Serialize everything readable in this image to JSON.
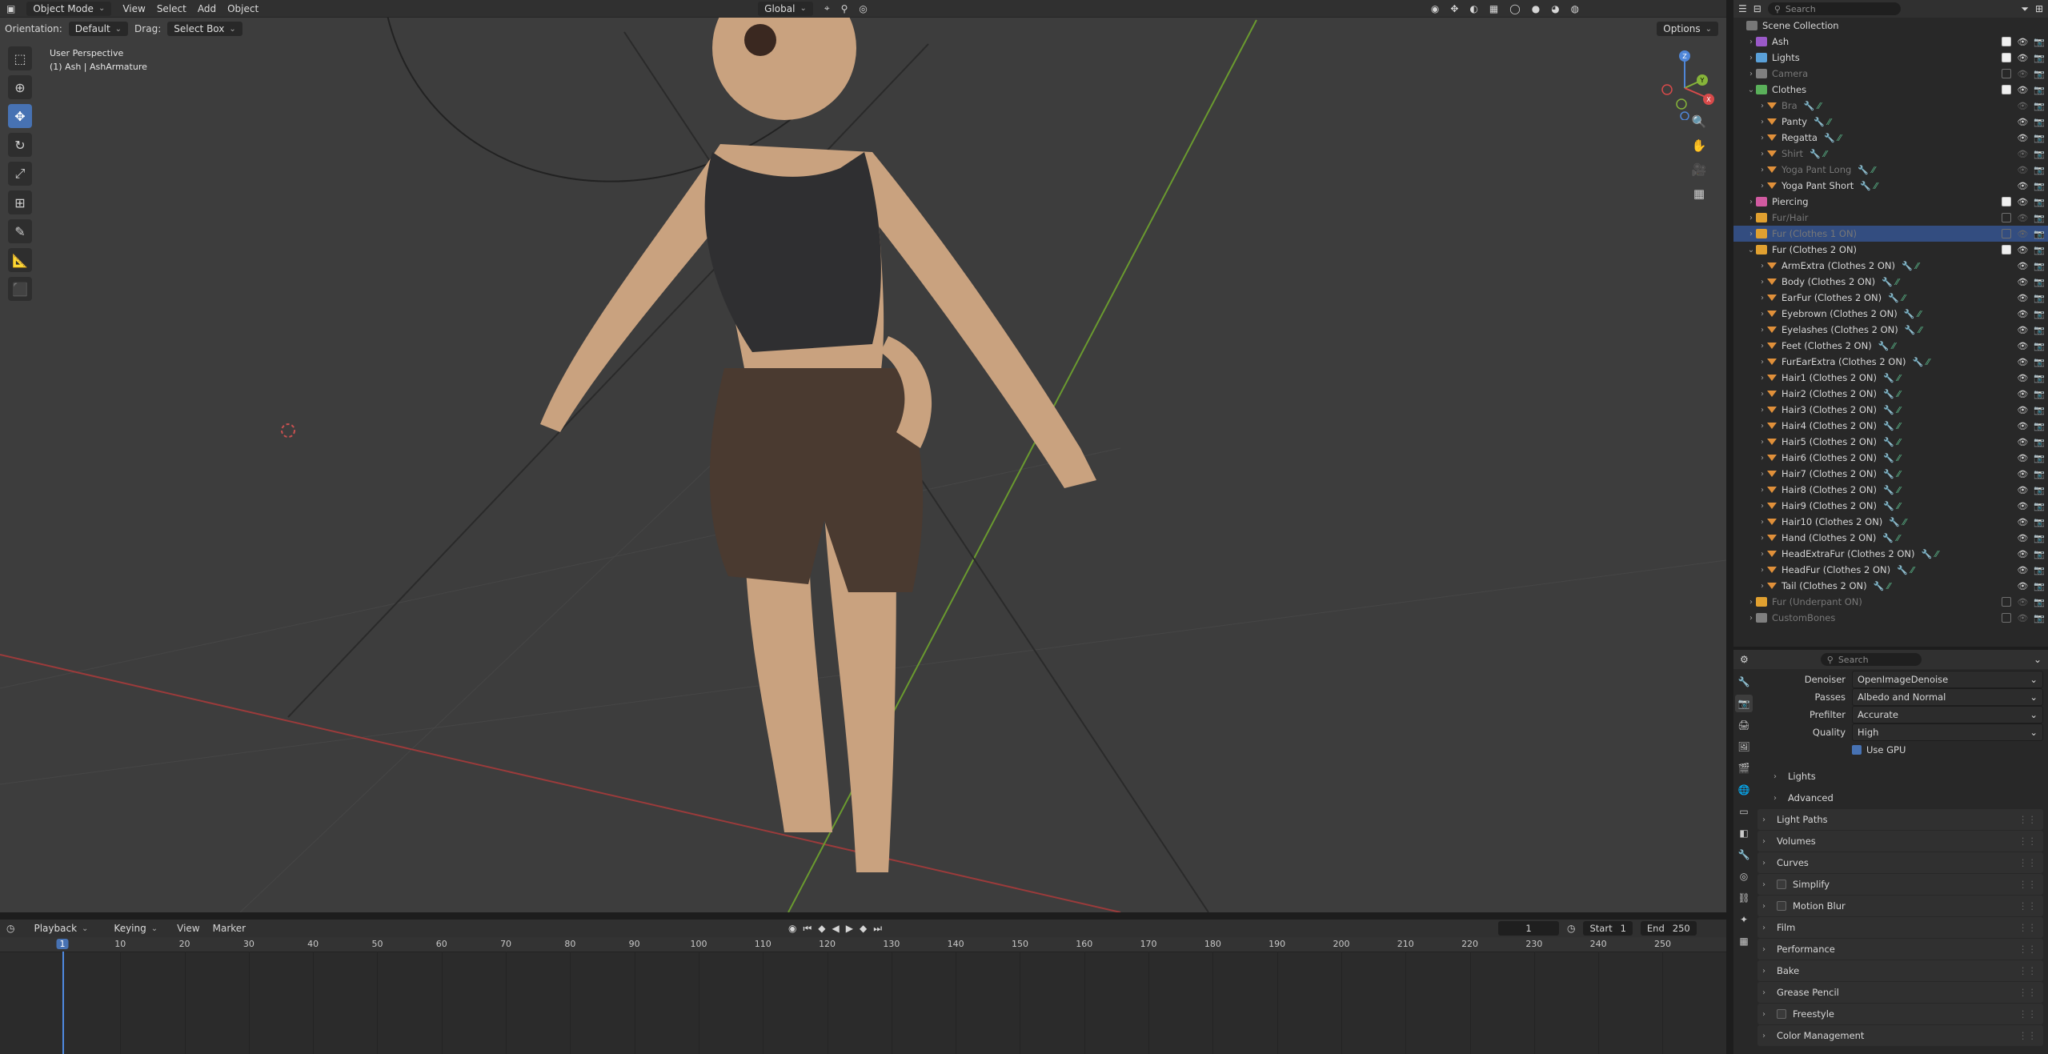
{
  "viewport": {
    "header": {
      "editor_icon": "3d-viewport-icon",
      "mode": "Object Mode",
      "menus": [
        "View",
        "Select",
        "Add",
        "Object"
      ],
      "transform": "Global",
      "options": "Options"
    },
    "header2": {
      "orientation_label": "Orientation:",
      "orientation_value": "Default",
      "drag_label": "Drag:",
      "drag_value": "Select Box"
    },
    "overlay": {
      "perspective": "User Perspective",
      "object": "(1) Ash | AshArmature"
    },
    "gizmo": {
      "x": "X",
      "y": "Y",
      "z": "Z"
    }
  },
  "outliner": {
    "search_placeholder": "Search",
    "root": "Scene Collection",
    "rows": [
      {
        "label": "Ash",
        "indent": 1,
        "color": "#9a59c8",
        "checked": true,
        "dim": false,
        "expanded": false
      },
      {
        "label": "Lights",
        "indent": 1,
        "color": "#5aa0d8",
        "checked": true,
        "dim": false,
        "expanded": false
      },
      {
        "label": "Camera",
        "indent": 1,
        "color": "#7f7f7f",
        "checked": false,
        "dim": true,
        "expanded": false
      },
      {
        "label": "Clothes",
        "indent": 1,
        "color": "#5ab05a",
        "checked": true,
        "dim": false,
        "expanded": true
      },
      {
        "label": "Bra",
        "indent": 2,
        "color": "#e0903a",
        "checked": null,
        "dim": true,
        "expanded": false
      },
      {
        "label": "Panty",
        "indent": 2,
        "color": "#e0903a",
        "checked": null,
        "dim": false,
        "expanded": false
      },
      {
        "label": "Regatta",
        "indent": 2,
        "color": "#e0903a",
        "checked": null,
        "dim": false,
        "expanded": false
      },
      {
        "label": "Shirt",
        "indent": 2,
        "color": "#e0903a",
        "checked": null,
        "dim": true,
        "expanded": false
      },
      {
        "label": "Yoga Pant Long",
        "indent": 2,
        "color": "#e0903a",
        "checked": null,
        "dim": true,
        "expanded": false
      },
      {
        "label": "Yoga Pant Short",
        "indent": 2,
        "color": "#e0903a",
        "checked": null,
        "dim": false,
        "expanded": false
      },
      {
        "label": "Piercing",
        "indent": 1,
        "color": "#d05aa0",
        "checked": true,
        "dim": false,
        "expanded": false
      },
      {
        "label": "Fur/Hair",
        "indent": 1,
        "color": "#e0a030",
        "checked": false,
        "dim": true,
        "expanded": false
      },
      {
        "label": "Fur (Clothes 1 ON)",
        "indent": 1,
        "color": "#e0a030",
        "checked": false,
        "dim": true,
        "expanded": false,
        "selected": true
      },
      {
        "label": "Fur (Clothes 2 ON)",
        "indent": 1,
        "color": "#e0a030",
        "checked": true,
        "dim": false,
        "expanded": true
      },
      {
        "label": "ArmExtra (Clothes 2 ON)",
        "indent": 2,
        "color": "#e0903a",
        "checked": null,
        "dim": false
      },
      {
        "label": "Body (Clothes 2 ON)",
        "indent": 2,
        "color": "#e0903a",
        "checked": null,
        "dim": false
      },
      {
        "label": "EarFur (Clothes 2 ON)",
        "indent": 2,
        "color": "#e0903a",
        "checked": null,
        "dim": false
      },
      {
        "label": "Eyebrown (Clothes 2 ON)",
        "indent": 2,
        "color": "#e0903a",
        "checked": null,
        "dim": false
      },
      {
        "label": "Eyelashes (Clothes 2 ON)",
        "indent": 2,
        "color": "#e0903a",
        "checked": null,
        "dim": false
      },
      {
        "label": "Feet (Clothes 2 ON)",
        "indent": 2,
        "color": "#e0903a",
        "checked": null,
        "dim": false
      },
      {
        "label": "FurEarExtra (Clothes 2 ON)",
        "indent": 2,
        "color": "#e0903a",
        "checked": null,
        "dim": false
      },
      {
        "label": "Hair1 (Clothes 2 ON)",
        "indent": 2,
        "color": "#e0903a",
        "checked": null,
        "dim": false
      },
      {
        "label": "Hair2 (Clothes 2 ON)",
        "indent": 2,
        "color": "#e0903a",
        "checked": null,
        "dim": false
      },
      {
        "label": "Hair3 (Clothes 2 ON)",
        "indent": 2,
        "color": "#e0903a",
        "checked": null,
        "dim": false
      },
      {
        "label": "Hair4 (Clothes 2 ON)",
        "indent": 2,
        "color": "#e0903a",
        "checked": null,
        "dim": false
      },
      {
        "label": "Hair5 (Clothes 2 ON)",
        "indent": 2,
        "color": "#e0903a",
        "checked": null,
        "dim": false
      },
      {
        "label": "Hair6 (Clothes 2 ON)",
        "indent": 2,
        "color": "#e0903a",
        "checked": null,
        "dim": false
      },
      {
        "label": "Hair7 (Clothes 2 ON)",
        "indent": 2,
        "color": "#e0903a",
        "checked": null,
        "dim": false
      },
      {
        "label": "Hair8 (Clothes 2 ON)",
        "indent": 2,
        "color": "#e0903a",
        "checked": null,
        "dim": false
      },
      {
        "label": "Hair9 (Clothes 2 ON)",
        "indent": 2,
        "color": "#e0903a",
        "checked": null,
        "dim": false
      },
      {
        "label": "Hair10 (Clothes 2 ON)",
        "indent": 2,
        "color": "#e0903a",
        "checked": null,
        "dim": false
      },
      {
        "label": "Hand (Clothes 2 ON)",
        "indent": 2,
        "color": "#e0903a",
        "checked": null,
        "dim": false
      },
      {
        "label": "HeadExtraFur (Clothes 2 ON)",
        "indent": 2,
        "color": "#e0903a",
        "checked": null,
        "dim": false
      },
      {
        "label": "HeadFur (Clothes 2 ON)",
        "indent": 2,
        "color": "#e0903a",
        "checked": null,
        "dim": false
      },
      {
        "label": "Tail (Clothes 2 ON)",
        "indent": 2,
        "color": "#e0903a",
        "checked": null,
        "dim": false
      },
      {
        "label": "Fur (Underpant ON)",
        "indent": 1,
        "color": "#e0a030",
        "checked": false,
        "dim": true
      },
      {
        "label": "CustomBones",
        "indent": 1,
        "color": "#7f7f7f",
        "checked": false,
        "dim": true
      }
    ]
  },
  "properties": {
    "search_placeholder": "Search",
    "denoiser": {
      "label": "Denoiser",
      "value": "OpenImageDenoise"
    },
    "passes": {
      "label": "Passes",
      "value": "Albedo and Normal"
    },
    "prefilter": {
      "label": "Prefilter",
      "value": "Accurate"
    },
    "quality": {
      "label": "Quality",
      "value": "High"
    },
    "use_gpu": "Use GPU",
    "subpanels": [
      "Lights",
      "Advanced"
    ],
    "panels": [
      {
        "label": "Light Paths",
        "checkbox": false
      },
      {
        "label": "Volumes",
        "checkbox": false
      },
      {
        "label": "Curves",
        "checkbox": false
      },
      {
        "label": "Simplify",
        "checkbox": true
      },
      {
        "label": "Motion Blur",
        "checkbox": true
      },
      {
        "label": "Film",
        "checkbox": false
      },
      {
        "label": "Performance",
        "checkbox": false
      },
      {
        "label": "Bake",
        "checkbox": false
      },
      {
        "label": "Grease Pencil",
        "checkbox": false
      },
      {
        "label": "Freestyle",
        "checkbox": true
      },
      {
        "label": "Color Management",
        "checkbox": false
      }
    ]
  },
  "timeline": {
    "menus": [
      "Playback",
      "Keying",
      "View",
      "Marker"
    ],
    "current_frame": "1",
    "start_label": "Start",
    "start_value": "1",
    "end_label": "End",
    "end_value": "250",
    "ticks": [
      "10",
      "20",
      "30",
      "40",
      "50",
      "60",
      "70",
      "80",
      "90",
      "100",
      "110",
      "120",
      "130",
      "140",
      "150",
      "160",
      "170",
      "180",
      "190",
      "200",
      "210",
      "220",
      "230",
      "240",
      "250"
    ],
    "playhead": "1"
  }
}
